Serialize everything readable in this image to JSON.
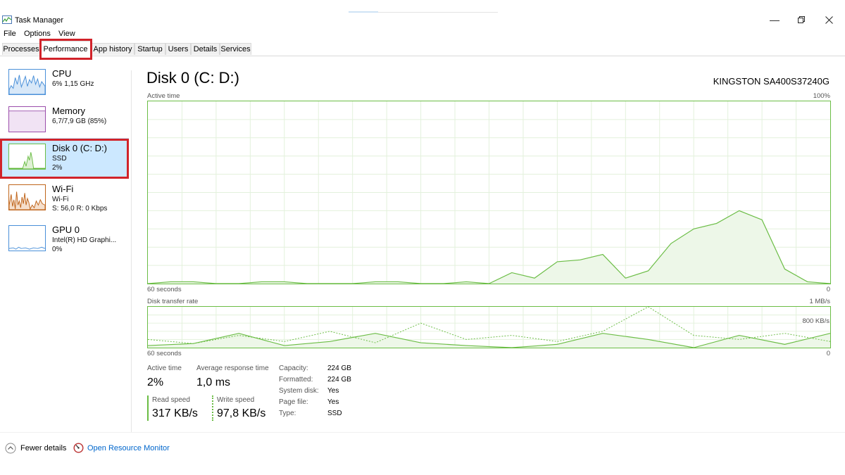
{
  "window": {
    "title": "Task Manager"
  },
  "menu": {
    "file": "File",
    "options": "Options",
    "view": "View"
  },
  "tabs": [
    "Processes",
    "Performance",
    "App history",
    "Startup",
    "Users",
    "Details",
    "Services"
  ],
  "sidebar": {
    "cpu": {
      "name": "CPU",
      "detail": "6%  1,15 GHz"
    },
    "memory": {
      "name": "Memory",
      "detail": "6,7/7,9 GB (85%)"
    },
    "disk": {
      "name": "Disk 0 (C: D:)",
      "detail1": "SSD",
      "detail2": "2%"
    },
    "wifi": {
      "name": "Wi-Fi",
      "detail1": "Wi-Fi",
      "detail2": "S: 56,0  R: 0 Kbps"
    },
    "gpu": {
      "name": "GPU 0",
      "detail1": "Intel(R) HD Graphi...",
      "detail2": "0%"
    }
  },
  "main": {
    "title": "Disk 0 (C: D:)",
    "model": "KINGSTON SA400S37240G",
    "active_time_graph": {
      "label": "Active time",
      "max_label": "100%",
      "time_label": "60 seconds",
      "min_label": "0"
    },
    "transfer_graph": {
      "label": "Disk transfer rate",
      "max_label": "1 MB/s",
      "mid_label": "800 KB/s",
      "time_label": "60 seconds",
      "min_label": "0"
    }
  },
  "stats": {
    "active_time_label": "Active time",
    "active_time_value": "2%",
    "avg_response_label": "Average response time",
    "avg_response_value": "1,0 ms",
    "read_label": "Read speed",
    "read_value": "317 KB/s",
    "write_label": "Write speed",
    "write_value": "97,8 KB/s"
  },
  "properties": [
    {
      "label": "Capacity:",
      "value": "224 GB"
    },
    {
      "label": "Formatted:",
      "value": "224 GB"
    },
    {
      "label": "System disk:",
      "value": "Yes"
    },
    {
      "label": "Page file:",
      "value": "Yes"
    },
    {
      "label": "Type:",
      "value": "SSD"
    }
  ],
  "footer": {
    "fewer_details": "Fewer details",
    "resource_monitor": "Open Resource Monitor"
  },
  "colors": {
    "accent": "#6bbd45",
    "selection": "#cce8ff",
    "highlight": "#d1232a",
    "cpu": "#4a90d9",
    "memory": "#9b4dab",
    "wifi": "#c0651b"
  },
  "chart_data": [
    {
      "type": "area",
      "title": "Active time",
      "ylim": [
        0,
        100
      ],
      "x": [
        60,
        58,
        56,
        54,
        52,
        50,
        48,
        46,
        44,
        42,
        40,
        38,
        36,
        34,
        32,
        30,
        28,
        26,
        24,
        22,
        20,
        18,
        16,
        14,
        12,
        10,
        8,
        6,
        4,
        2,
        0
      ],
      "series": [
        {
          "values": [
            0,
            1,
            1,
            0,
            0,
            1,
            1,
            0,
            0,
            0,
            1,
            1,
            0,
            0,
            1,
            0,
            6,
            3,
            12,
            13,
            16,
            3,
            7,
            22,
            30,
            33,
            40,
            35,
            8,
            1,
            0
          ]
        }
      ]
    },
    {
      "type": "line",
      "title": "Disk transfer rate",
      "ylim": [
        0,
        1000
      ],
      "x": [
        60,
        56,
        52,
        48,
        44,
        40,
        36,
        32,
        28,
        24,
        20,
        16,
        12,
        8,
        4,
        0
      ],
      "series": [
        {
          "values": [
            50,
            100,
            350,
            50,
            150,
            350,
            120,
            50,
            0,
            80,
            350,
            200,
            0,
            300,
            80,
            350
          ]
        },
        {
          "values": [
            200,
            100,
            300,
            150,
            400,
            120,
            600,
            200,
            300,
            150,
            400,
            1000,
            300,
            200,
            350,
            150
          ]
        }
      ]
    }
  ]
}
